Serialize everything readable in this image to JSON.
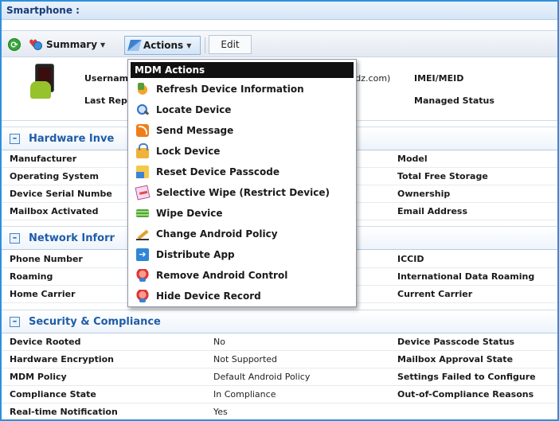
{
  "window": {
    "title": "Smartphone :"
  },
  "toolbar": {
    "summary_label": "Summary",
    "actions_label": "Actions",
    "edit_label": "Edit",
    "caret": "▼"
  },
  "device": {
    "username_label": "Usernam",
    "username_value_fragment": ")dz.com)",
    "last_report_label": "Last Rep",
    "imei_label": "IMEI/MEID",
    "managed_status_label": "Managed Status"
  },
  "sections": {
    "hardware": {
      "title": "Hardware Inve",
      "rows": [
        {
          "left": "Manufacturer",
          "mid": "",
          "right": "Model"
        },
        {
          "left": "Operating System",
          "mid": "",
          "right": "Total Free Storage"
        },
        {
          "left": "Device Serial Numbe",
          "mid": "",
          "right": "Ownership"
        },
        {
          "left": "Mailbox Activated",
          "mid": "",
          "right": "Email Address"
        }
      ]
    },
    "network": {
      "title": "Network Inforr",
      "rows": [
        {
          "left": "Phone Number",
          "mid": "",
          "right": "ICCID"
        },
        {
          "left": "Roaming",
          "mid": "",
          "right": "International Data Roaming"
        },
        {
          "left": "Home Carrier",
          "mid": "",
          "right": "Current Carrier"
        }
      ]
    },
    "security": {
      "title": "Security & Compliance",
      "rows": [
        {
          "left": "Device Rooted",
          "mid": "No",
          "right": "Device Passcode Status"
        },
        {
          "left": "Hardware Encryption",
          "mid": "Not Supported",
          "right": "Mailbox Approval State"
        },
        {
          "left": "MDM Policy",
          "mid": "Default Android Policy",
          "right": "Settings Failed to Configure"
        },
        {
          "left": "Compliance State",
          "mid": "In Compliance",
          "right": "Out-of-Compliance Reasons"
        },
        {
          "left": "Real-time Notification",
          "mid": "Yes",
          "right": ""
        }
      ]
    }
  },
  "actions_menu": {
    "header": "MDM Actions",
    "items": [
      {
        "label": "Refresh Device Information",
        "icon": "refresh-device-icon"
      },
      {
        "label": "Locate Device",
        "icon": "magnifier-icon"
      },
      {
        "label": "Send Message",
        "icon": "rss-icon"
      },
      {
        "label": "Lock Device",
        "icon": "lock-icon"
      },
      {
        "label": "Reset Device Passcode",
        "icon": "reset-passcode-icon"
      },
      {
        "label": "Selective Wipe (Restrict Device)",
        "icon": "eraser-icon"
      },
      {
        "label": "Wipe Device",
        "icon": "wipe-icon"
      },
      {
        "label": "Change Android Policy",
        "icon": "pencil-icon"
      },
      {
        "label": "Distribute App",
        "icon": "distribute-arrow-icon"
      },
      {
        "label": "Remove Android Control",
        "icon": "android-remove-icon"
      },
      {
        "label": "Hide Device Record",
        "icon": "android-hide-icon"
      }
    ]
  },
  "colors": {
    "frame_border": "#2e8fdc",
    "section_title": "#1f5ca8",
    "menu_header_bg": "#111111"
  }
}
